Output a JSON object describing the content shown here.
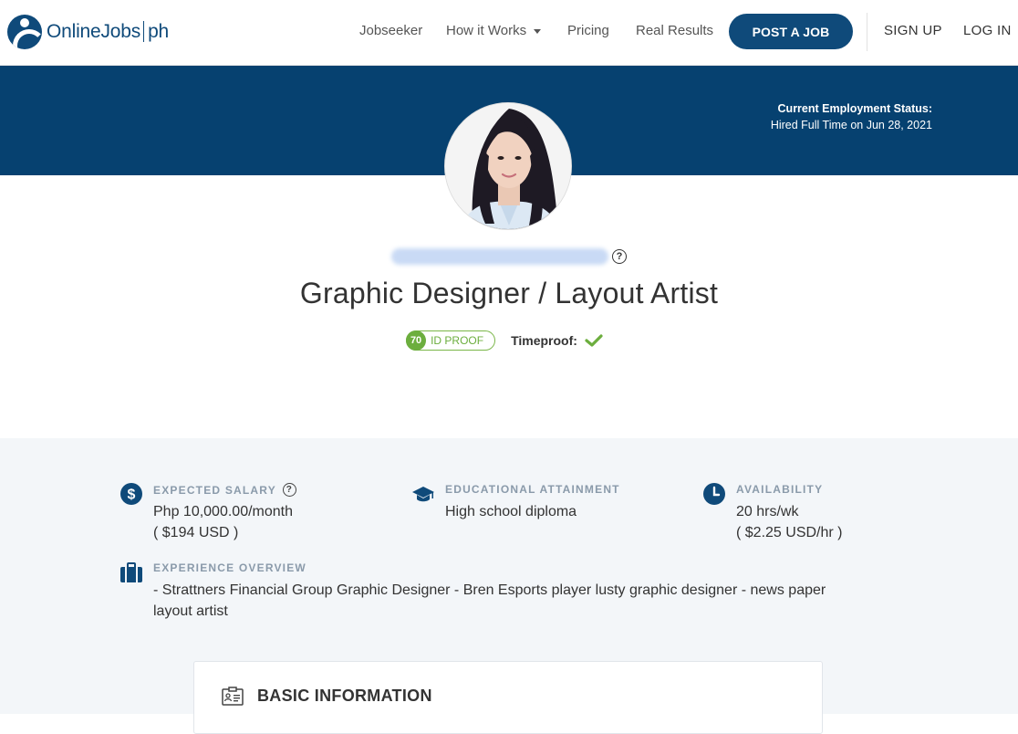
{
  "brand": {
    "name": "OnlineJobs",
    "suffix": "ph"
  },
  "nav": {
    "links": [
      "Jobseeker",
      "How it Works",
      "Pricing",
      "Real Results"
    ],
    "post_job": "POST A JOB",
    "sign_up": "SIGN UP",
    "log_in": "LOG IN"
  },
  "employment": {
    "label": "Current Employment Status:",
    "value": "Hired Full Time on Jun 28, 2021"
  },
  "profile": {
    "title": "Graphic Designer / Layout Artist",
    "id_proof_score": "70",
    "id_proof_label": "ID PROOF",
    "timeproof_label": "Timeproof:"
  },
  "stats": {
    "salary": {
      "label": "EXPECTED SALARY",
      "value": "Php 10,000.00/month",
      "sub": "( $194 USD )"
    },
    "education": {
      "label": "EDUCATIONAL ATTAINMENT",
      "value": "High school diploma"
    },
    "availability": {
      "label": "AVAILABILITY",
      "value": "20 hrs/wk",
      "sub": "( $2.25 USD/hr )"
    },
    "experience": {
      "label": "EXPERIENCE OVERVIEW",
      "line1": "- Strattners Financial Group Graphic Designer - Bren Esports player lusty graphic designer - news paper",
      "line2": "layout artist"
    }
  },
  "card": {
    "title": "BASIC INFORMATION"
  },
  "colors": {
    "brand": "#064170",
    "green": "#6cae3e",
    "label": "#8a9aaa",
    "section_bg": "#f3f6f9"
  }
}
